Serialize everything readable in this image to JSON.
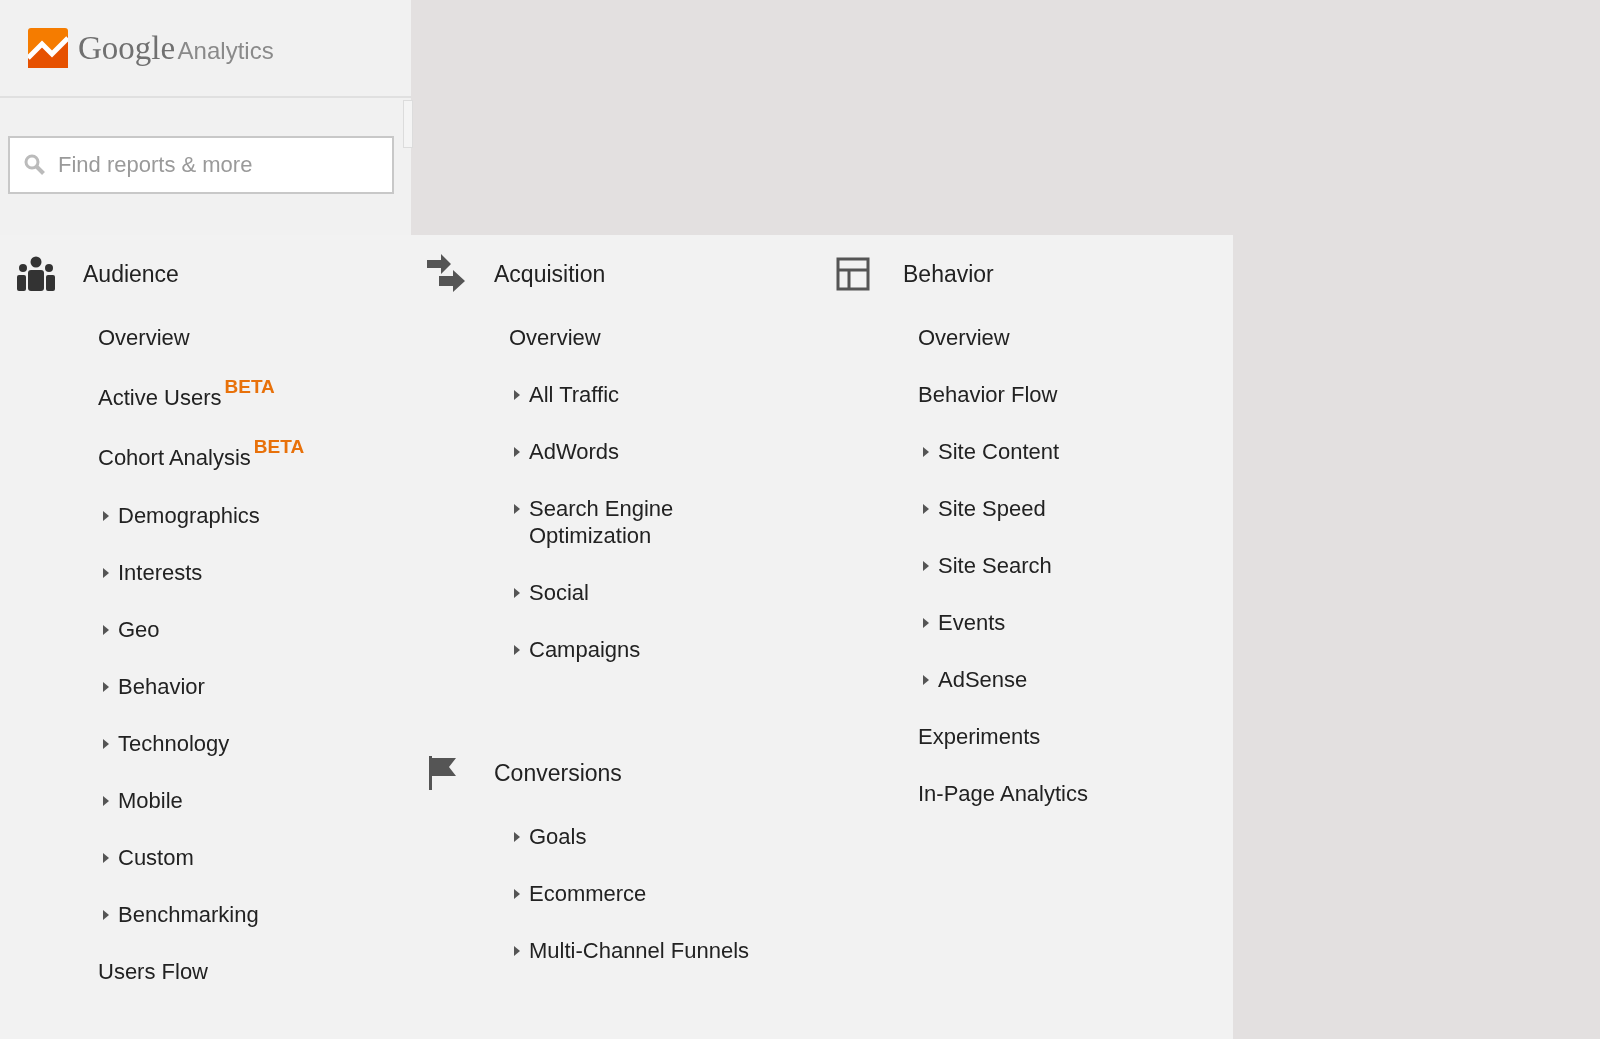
{
  "logo": {
    "brand": "Google",
    "product": "Analytics"
  },
  "search": {
    "placeholder": "Find reports & more"
  },
  "columns": [
    {
      "sections": [
        {
          "title": "Audience",
          "items": [
            {
              "label": "Overview",
              "kind": "link"
            },
            {
              "label": "Active Users",
              "kind": "link",
              "badge": "BETA"
            },
            {
              "label": "Cohort Analysis",
              "kind": "link",
              "badge": "BETA"
            },
            {
              "label": "Demographics",
              "kind": "expandable"
            },
            {
              "label": "Interests",
              "kind": "expandable"
            },
            {
              "label": "Geo",
              "kind": "expandable"
            },
            {
              "label": "Behavior",
              "kind": "expandable"
            },
            {
              "label": "Technology",
              "kind": "expandable"
            },
            {
              "label": "Mobile",
              "kind": "expandable"
            },
            {
              "label": "Custom",
              "kind": "expandable"
            },
            {
              "label": "Benchmarking",
              "kind": "expandable"
            },
            {
              "label": "Users Flow",
              "kind": "link"
            }
          ]
        }
      ]
    },
    {
      "sections": [
        {
          "title": "Acquisition",
          "items": [
            {
              "label": "Overview",
              "kind": "link"
            },
            {
              "label": "All Traffic",
              "kind": "expandable"
            },
            {
              "label": "AdWords",
              "kind": "expandable"
            },
            {
              "label": "Search Engine Optimization",
              "kind": "expandable"
            },
            {
              "label": "Social",
              "kind": "expandable"
            },
            {
              "label": "Campaigns",
              "kind": "expandable"
            }
          ]
        },
        {
          "title": "Conversions",
          "items": [
            {
              "label": "Goals",
              "kind": "expandable"
            },
            {
              "label": "Ecommerce",
              "kind": "expandable"
            },
            {
              "label": "Multi-Channel Funnels",
              "kind": "expandable"
            }
          ]
        }
      ]
    },
    {
      "sections": [
        {
          "title": "Behavior",
          "items": [
            {
              "label": "Overview",
              "kind": "link"
            },
            {
              "label": "Behavior Flow",
              "kind": "link"
            },
            {
              "label": "Site Content",
              "kind": "expandable"
            },
            {
              "label": "Site Speed",
              "kind": "expandable"
            },
            {
              "label": "Site Search",
              "kind": "expandable"
            },
            {
              "label": "Events",
              "kind": "expandable"
            },
            {
              "label": "AdSense",
              "kind": "expandable"
            },
            {
              "label": "Experiments",
              "kind": "link"
            },
            {
              "label": "In-Page Analytics",
              "kind": "link"
            }
          ]
        }
      ]
    }
  ]
}
